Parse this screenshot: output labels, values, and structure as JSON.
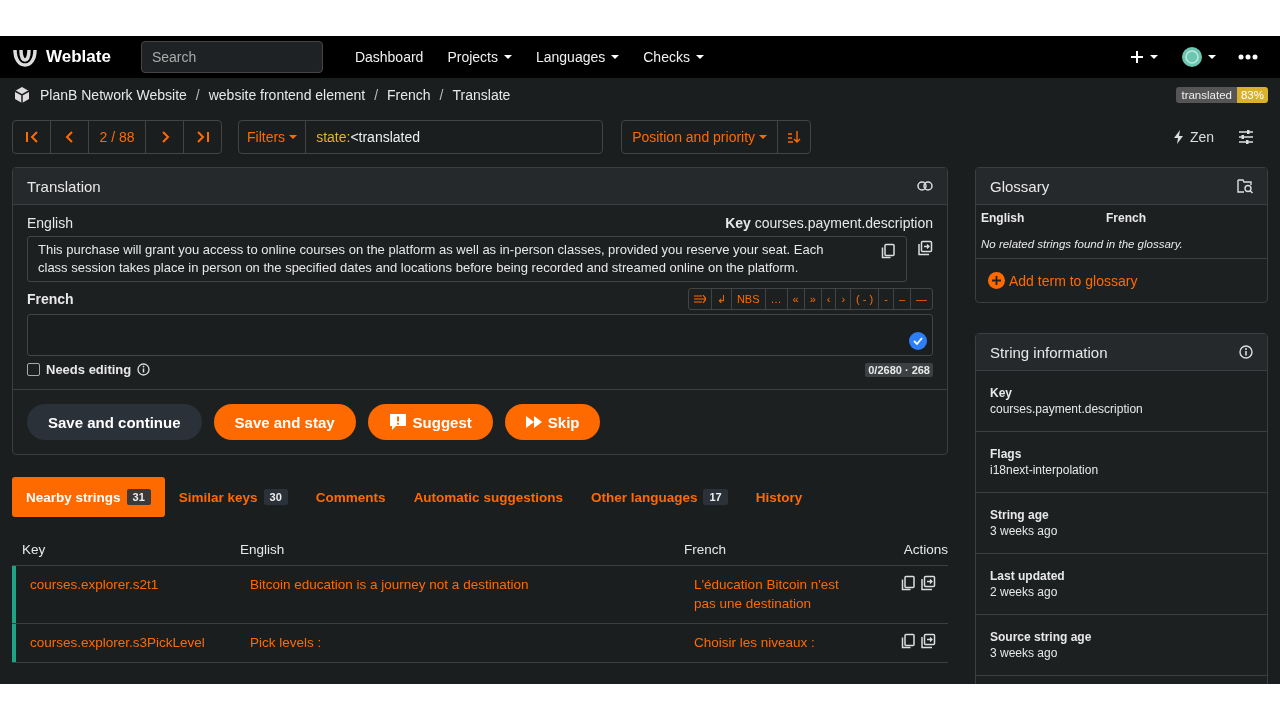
{
  "navbar": {
    "brand": "Weblate",
    "search_placeholder": "Search",
    "menu": [
      {
        "label": "Dashboard",
        "dropdown": false
      },
      {
        "label": "Projects",
        "dropdown": true
      },
      {
        "label": "Languages",
        "dropdown": true
      },
      {
        "label": "Checks",
        "dropdown": true
      }
    ]
  },
  "breadcrumb": {
    "items": [
      "PlanB Network Website",
      "website frontend element",
      "French",
      "Translate"
    ],
    "separator": "/"
  },
  "status_badge": {
    "label": "translated",
    "value": "83%"
  },
  "pager": {
    "position": "2 / 88"
  },
  "filter": {
    "button": "Filters",
    "query_key": "state:",
    "query_rest": "<translated"
  },
  "sort": {
    "label": "Position and priority"
  },
  "zen": "Zen",
  "translation": {
    "title": "Translation",
    "source_language": "English",
    "key_label": "Key",
    "key": "courses.payment.description",
    "source_text": "This purchase will grant you access to online courses on the platform as well as in-person classes, provided you reserve your seat. Each class session takes place in person on the specified dates and locations before being recorded and streamed online on the platform.",
    "target_language": "French",
    "special_chars": [
      "↲",
      "NBS",
      "…",
      "«",
      "»",
      "‹",
      "›",
      "( - )",
      "-",
      "–",
      "—"
    ],
    "needs_editing": {
      "label": "Needs editing",
      "checked": false
    },
    "counter": "0/2680 · 268",
    "buttons": [
      {
        "label": "Save and continue",
        "kind": "secondary"
      },
      {
        "label": "Save and stay",
        "kind": "primary"
      },
      {
        "label": "Suggest",
        "kind": "suggest"
      },
      {
        "label": "Skip",
        "kind": "skip"
      }
    ]
  },
  "tabs": [
    {
      "label": "Nearby strings",
      "count": "31",
      "selected": true
    },
    {
      "label": "Similar keys",
      "count": "30",
      "selected": false
    },
    {
      "label": "Comments",
      "selected": false
    },
    {
      "label": "Automatic suggestions",
      "selected": false
    },
    {
      "label": "Other languages",
      "count": "17",
      "selected": false
    },
    {
      "label": "History",
      "selected": false
    }
  ],
  "table": {
    "columns": [
      "Key",
      "English",
      "French",
      "Actions"
    ],
    "rows": [
      {
        "key": "courses.explorer.s2t1",
        "english": "Bitcoin education is a journey not a destination",
        "french": "L'éducation Bitcoin n'est pas une destination",
        "color": "#20a383"
      },
      {
        "key": "courses.explorer.s3PickLevel",
        "english": "Pick levels :",
        "french": "Choisir les niveaux :",
        "color": "#20a383"
      }
    ]
  },
  "glossary": {
    "title": "Glossary",
    "columns": [
      "English",
      "French"
    ],
    "empty": "No related strings found in the glossary.",
    "add": "Add term to glossary"
  },
  "string_info": {
    "title": "String information",
    "items": [
      {
        "label": "Key",
        "value": "courses.payment.description"
      },
      {
        "label": "Flags",
        "value": "i18next-interpolation"
      },
      {
        "label": "String age",
        "value": "3 weeks ago"
      },
      {
        "label": "Last updated",
        "value": "2 weeks ago"
      },
      {
        "label": "Source string age",
        "value": "3 weeks ago"
      }
    ]
  }
}
